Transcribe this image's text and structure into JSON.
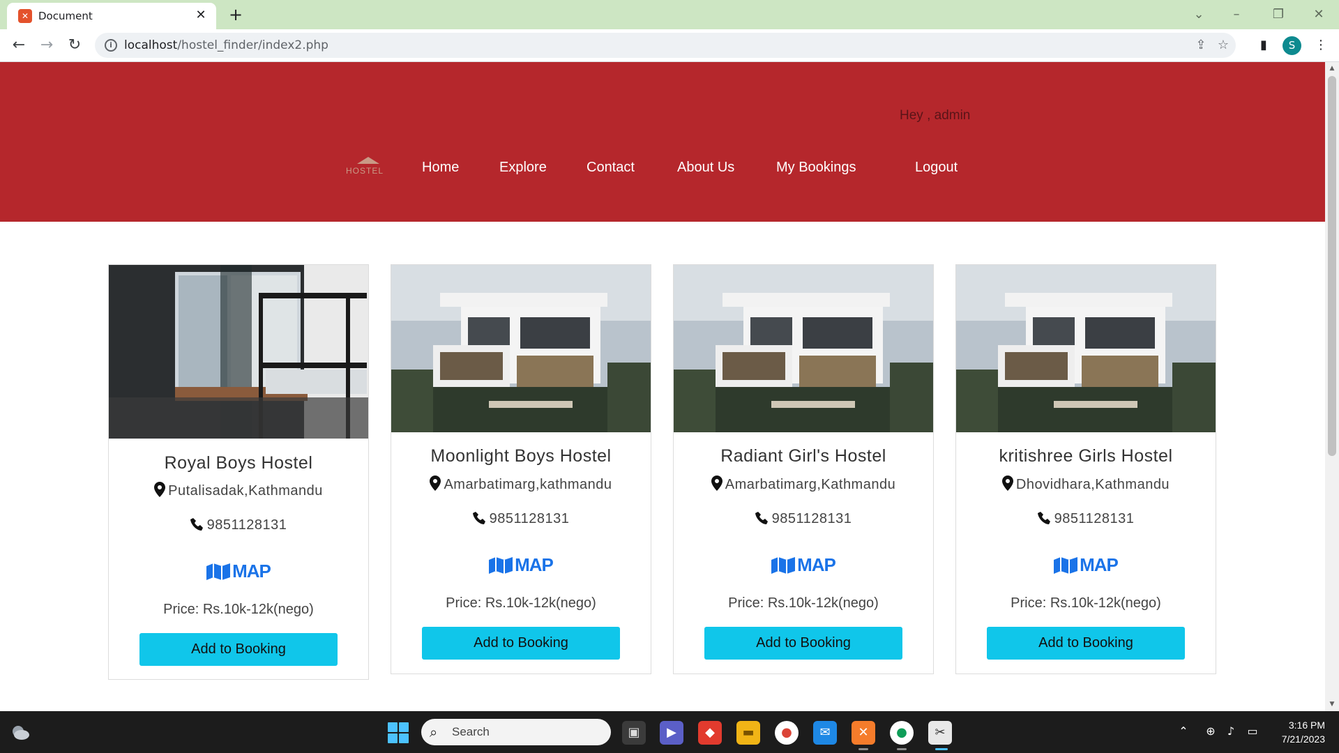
{
  "browser": {
    "tab_title": "Document",
    "url_host": "localhost",
    "url_path": "/hostel_finder/index2.php",
    "profile_initial": "S"
  },
  "header": {
    "greeting": "Hey , admin",
    "logo_text": "HOSTEL",
    "nav": [
      "Home",
      "Explore",
      "Contact",
      "About Us",
      "My Bookings",
      "Logout"
    ],
    "background_color": "#b5272c"
  },
  "cards": [
    {
      "name": "Royal Boys Hostel",
      "location": "Putalisadak,Kathmandu",
      "phone": "9851128131",
      "map_label": "MAP",
      "price": "Price: Rs.10k-12k(nego)",
      "button": "Add to Booking",
      "image": "hostel-room-bunk-bed"
    },
    {
      "name": "Moonlight Boys Hostel",
      "location": "Amarbatimarg,kathmandu",
      "phone": "9851128131",
      "map_label": "MAP",
      "price": "Price: Rs.10k-12k(nego)",
      "button": "Add to Booking",
      "image": "modern-house-exterior"
    },
    {
      "name": "Radiant Girl's Hostel",
      "location": "Amarbatimarg,Kathmandu",
      "phone": "9851128131",
      "map_label": "MAP",
      "price": "Price: Rs.10k-12k(nego)",
      "button": "Add to Booking",
      "image": "modern-house-exterior"
    },
    {
      "name": "kritishree Girls Hostel",
      "location": "Dhovidhara,Kathmandu",
      "phone": "9851128131",
      "map_label": "MAP",
      "price": "Price: Rs.10k-12k(nego)",
      "button": "Add to Booking",
      "image": "modern-house-exterior"
    }
  ],
  "taskbar": {
    "search_placeholder": "Search",
    "time": "3:16 PM",
    "date": "7/21/2023"
  }
}
